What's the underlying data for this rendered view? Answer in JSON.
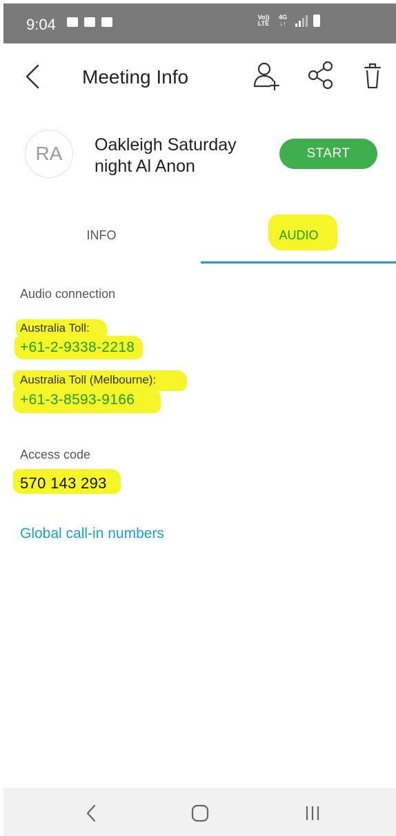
{
  "status_bar": {
    "time": "9:04",
    "left_icons": [
      "image-icon",
      "mail-icon",
      "voicemail-icon"
    ],
    "volte_label_top": "Vo))",
    "volte_label_bottom": "LTE",
    "network_label_top": "4G",
    "network_label_bottom": "↓↑"
  },
  "header": {
    "title": "Meeting Info",
    "icons": [
      "back-icon",
      "add-user-icon",
      "share-icon",
      "trash-icon"
    ]
  },
  "meeting": {
    "avatar_initials": "RA",
    "title": "Oakleigh Saturday night Al Anon",
    "start_label": "START"
  },
  "tabs": [
    {
      "label": "INFO",
      "selected": false
    },
    {
      "label": "AUDIO",
      "selected": true
    }
  ],
  "audio": {
    "section_label": "Audio connection",
    "entries": [
      {
        "label": "Australia Toll:",
        "number": "+61-2-9338-2218"
      },
      {
        "label": "Australia Toll (Melbourne):",
        "number": "+61-3-8593-9166"
      }
    ],
    "access_code_label": "Access code",
    "access_code": "570 143 293",
    "global_link": "Global call-in numbers"
  },
  "colors": {
    "accent_green": "#3faf4e",
    "link_blue": "#1a9ed6",
    "highlight_yellow": "#f5f527"
  }
}
